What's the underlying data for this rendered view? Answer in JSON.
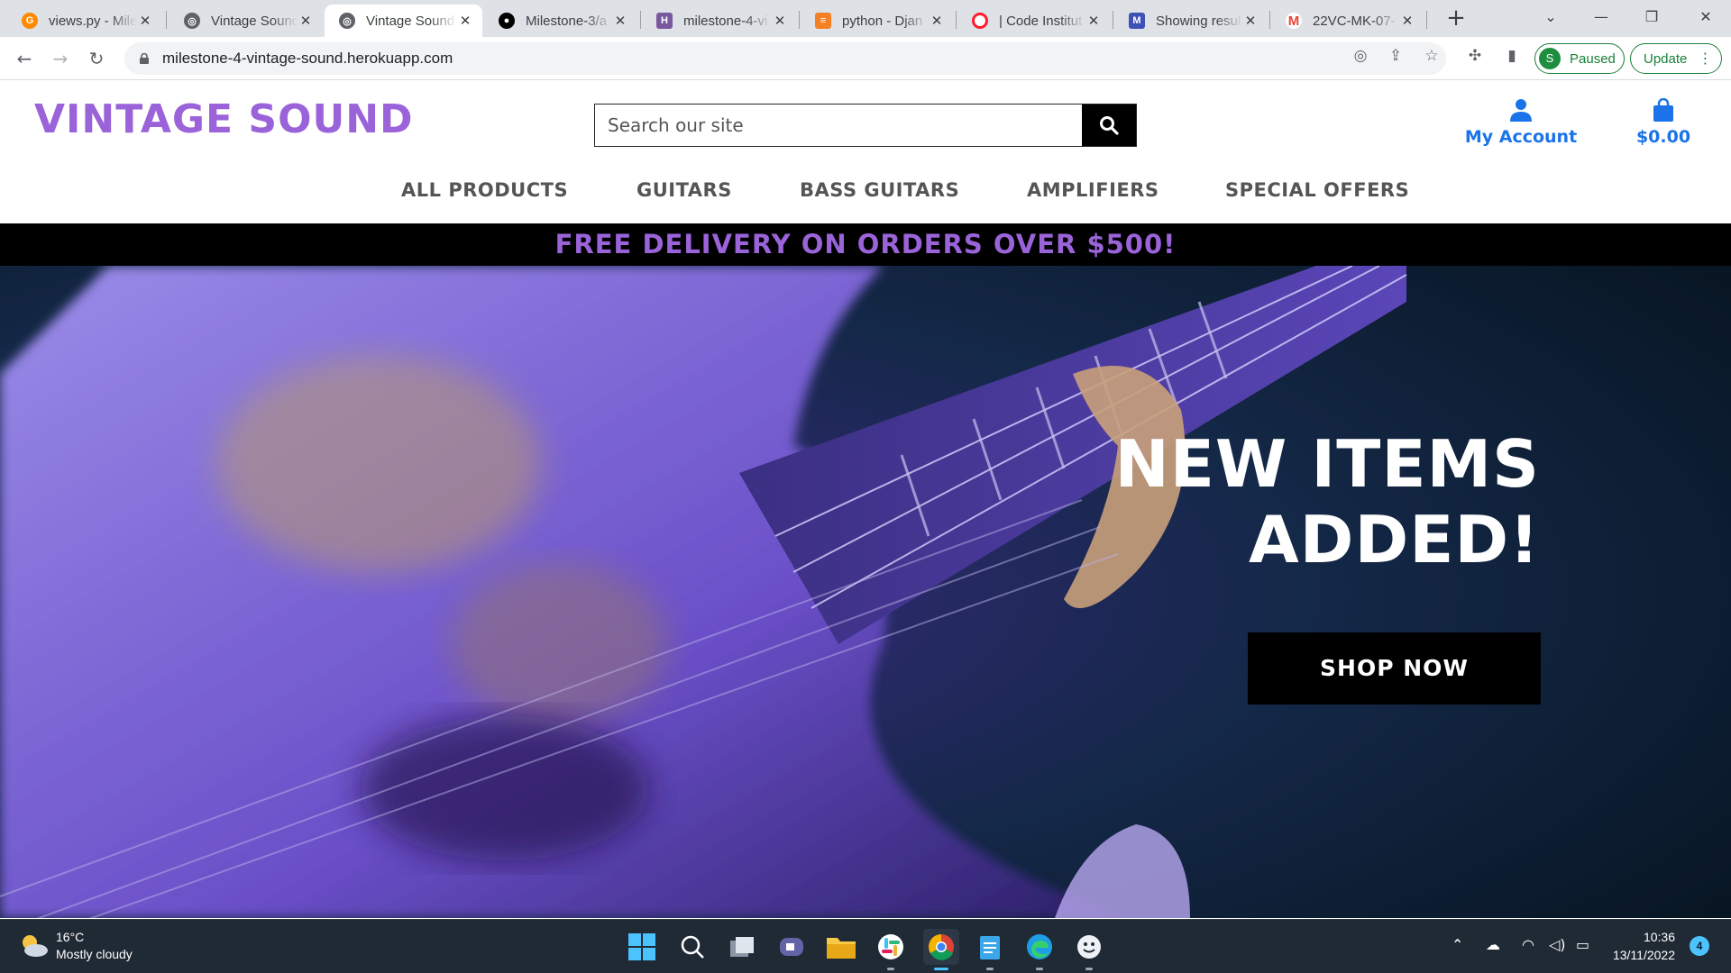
{
  "browser": {
    "tabs": [
      {
        "title": "views.py - Mile",
        "favicon": "gitpod-icon",
        "color": "#ff8a00"
      },
      {
        "title": "Vintage Sound",
        "favicon": "globe-icon",
        "color": "#5f6368"
      },
      {
        "title": "Vintage Sound",
        "favicon": "globe-icon",
        "color": "#5f6368"
      },
      {
        "title": "Milestone-3/a",
        "favicon": "github-icon",
        "color": "#000000"
      },
      {
        "title": "milestone-4-vi",
        "favicon": "heroku-icon",
        "color": "#79589f"
      },
      {
        "title": "python - Djan",
        "favicon": "stackoverflow-icon",
        "color": "#f48024"
      },
      {
        "title": "| Code Institut",
        "favicon": "opera-icon",
        "color": "#ff1b2d"
      },
      {
        "title": "Showing resul",
        "favicon": "mongo-icon",
        "color": "#3f51b5"
      },
      {
        "title": "22VC-MK-07-",
        "favicon": "gmail-icon",
        "color": "#ea4335"
      }
    ],
    "active_tab": 2,
    "url": "milestone-4-vintage-sound.herokuapp.com",
    "profile_initial": "S",
    "profile_status": "Paused",
    "update_label": "Update"
  },
  "site": {
    "logo": "VINTAGE SOUND",
    "search_placeholder": "Search our site",
    "account_label": "My Account",
    "bag_total": "$0.00",
    "nav": [
      "ALL PRODUCTS",
      "GUITARS",
      "BASS GUITARS",
      "AMPLIFIERS",
      "SPECIAL OFFERS"
    ],
    "banner": "FREE DELIVERY ON ORDERS OVER $500!",
    "hero_title_line1": "NEW ITEMS",
    "hero_title_line2": "ADDED!",
    "hero_button": "SHOP NOW",
    "accent_color": "#9b63d9",
    "link_color": "#1a73e8"
  },
  "taskbar": {
    "temperature": "16°C",
    "weather": "Mostly cloudy",
    "time": "10:36",
    "date": "13/11/2022",
    "notifications": "4"
  }
}
